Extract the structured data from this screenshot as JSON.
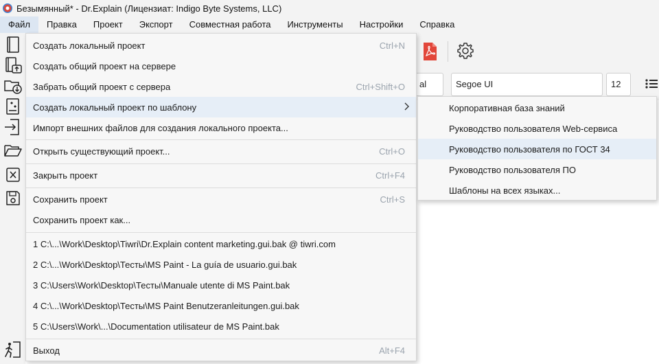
{
  "window": {
    "title": "Безымянный* - Dr.Explain (Лицензиат: Indigo Byte Systems, LLC)"
  },
  "menubar": {
    "items": [
      "Файл",
      "Правка",
      "Проект",
      "Экспорт",
      "Совместная работа",
      "Инструменты",
      "Настройки",
      "Справка"
    ]
  },
  "toolbar": {
    "style_value": "al",
    "font_value": "Segoe UI",
    "size_value": "12"
  },
  "file_menu": {
    "items": [
      {
        "label": "Создать локальный проект",
        "shortcut": "Ctrl+N",
        "icon": "book-icon"
      },
      {
        "label": "Создать общий проект на сервере",
        "shortcut": "",
        "icon": "book-upload-icon"
      },
      {
        "label": "Забрать общий проект с сервера",
        "shortcut": "Ctrl+Shift+O",
        "icon": "folder-download-icon"
      },
      {
        "label": "Создать локальный проект по шаблону",
        "shortcut": "",
        "icon": "template-book-icon"
      },
      {
        "label": "Импорт внешних файлов для создания локального проекта...",
        "shortcut": "",
        "icon": "import-icon"
      },
      {
        "label": "Открыть существующий проект...",
        "shortcut": "Ctrl+O",
        "icon": "folder-open-icon"
      },
      {
        "label": "Закрыть проект",
        "shortcut": "Ctrl+F4",
        "icon": "close-box-icon"
      },
      {
        "label": "Сохранить проект",
        "shortcut": "Ctrl+S",
        "icon": "save-icon"
      },
      {
        "label": "Сохранить проект как...",
        "shortcut": "",
        "icon": ""
      },
      {
        "label": "1 C:\\...\\Work\\Desktop\\Tiwri\\Dr.Explain content marketing.gui.bak @ tiwri.com",
        "shortcut": ""
      },
      {
        "label": "2 C:\\...\\Work\\Desktop\\Тесты\\MS Paint - La guía de usuario.gui.bak",
        "shortcut": ""
      },
      {
        "label": "3 C:\\Users\\Work\\Desktop\\Тесты\\Manuale utente di MS Paint.bak",
        "shortcut": ""
      },
      {
        "label": "4 C:\\...\\Work\\Desktop\\Тесты\\MS Paint Benutzeranleitungen.gui.bak",
        "shortcut": ""
      },
      {
        "label": "5 C:\\Users\\Work\\...\\Documentation utilisateur de MS Paint.bak",
        "shortcut": ""
      },
      {
        "label": "Выход",
        "shortcut": "Alt+F4",
        "icon": "exit-icon"
      }
    ]
  },
  "sub_menu": {
    "items": [
      "Корпоративная база знаний",
      "Руководство пользователя Web-сервиса",
      "Руководство пользователя по ГОСТ 34",
      "Руководство пользователя ПО",
      "Шаблоны на всех языках..."
    ]
  },
  "colors": {
    "highlight": "#e6eef7",
    "shortcut": "#9aa3ad",
    "pdf_red": "#e2463a"
  }
}
